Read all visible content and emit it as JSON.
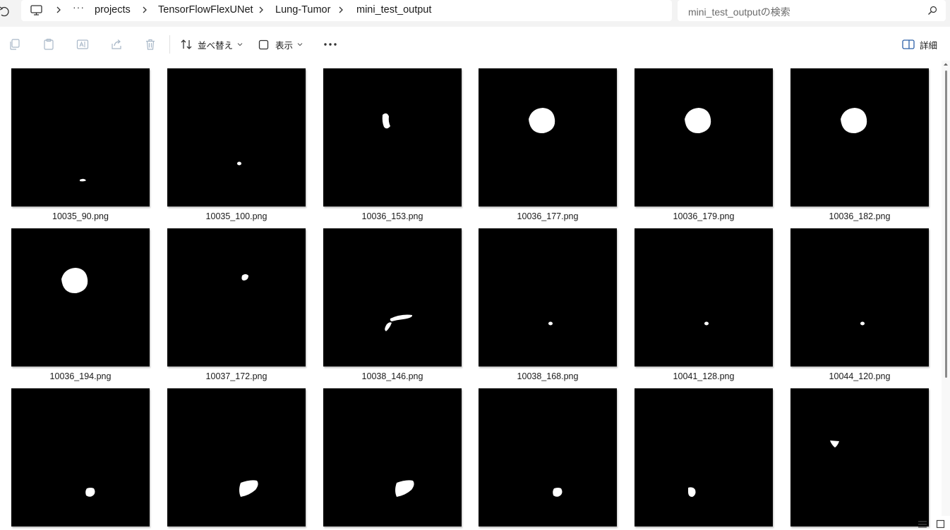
{
  "address": {
    "crumbs": [
      "projects",
      "TensorFlowFlexUNet",
      "Lung-Tumor",
      "mini_test_output"
    ],
    "search_placeholder": "mini_test_outputの検索"
  },
  "toolbar": {
    "sort_label": "並べ替え",
    "view_label": "表示",
    "details_label": "詳細"
  },
  "files": [
    {
      "name": "10035_90.png",
      "blob": "tiny-streak"
    },
    {
      "name": "10035_100.png",
      "blob": "dot"
    },
    {
      "name": "10036_153.png",
      "blob": "small-upper"
    },
    {
      "name": "10036_177.png",
      "blob": "round-large"
    },
    {
      "name": "10036_179.png",
      "blob": "round-large"
    },
    {
      "name": "10036_182.png",
      "blob": "round-large"
    },
    {
      "name": "10036_194.png",
      "blob": "round-large"
    },
    {
      "name": "10037_172.png",
      "blob": "small"
    },
    {
      "name": "10038_146.png",
      "blob": "elongated"
    },
    {
      "name": "10038_168.png",
      "blob": "dot"
    },
    {
      "name": "10041_128.png",
      "blob": "dot"
    },
    {
      "name": "10044_120.png",
      "blob": "dot"
    },
    {
      "name": "",
      "blob": "medium-low"
    },
    {
      "name": "",
      "blob": "leaf"
    },
    {
      "name": "",
      "blob": "leaf"
    },
    {
      "name": "",
      "blob": "medium-low"
    },
    {
      "name": "",
      "blob": "small-low"
    },
    {
      "name": "",
      "blob": "triangle"
    }
  ]
}
